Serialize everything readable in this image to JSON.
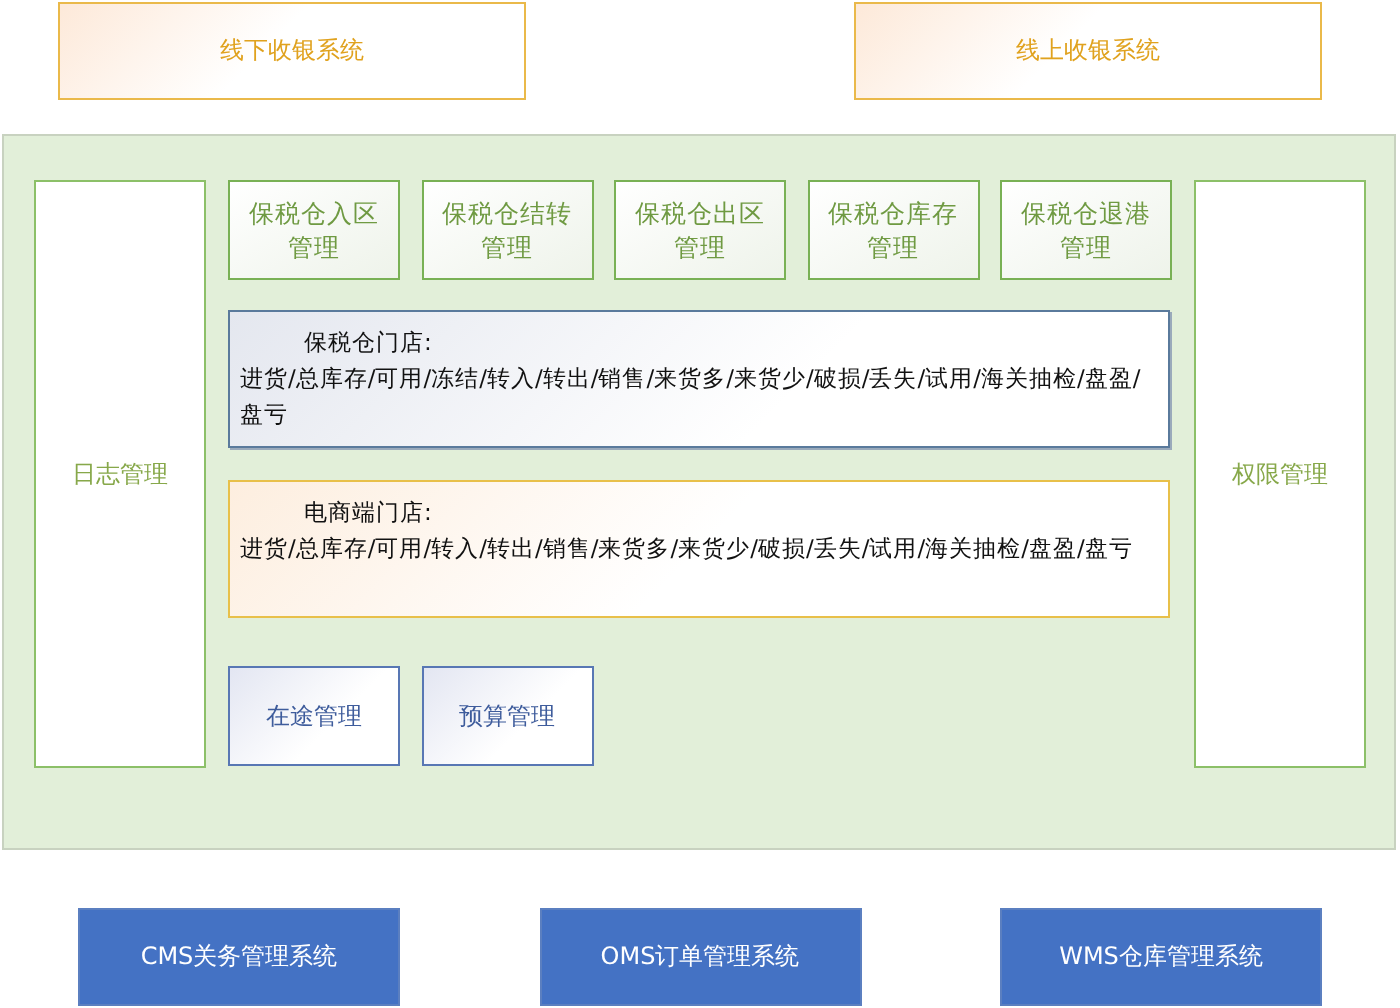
{
  "top_systems": [
    "线下收银系统",
    "线上收银系统"
  ],
  "log_panel": "日志管理",
  "modules": [
    "保税仓入区管理",
    "保税仓结转管理",
    "保税仓出区管理",
    "保税仓库存管理",
    "保税仓退港管理"
  ],
  "stores": [
    {
      "kind": "bonded",
      "title": "保税仓门店:",
      "items": "进货/总库存/可用/冻结/转入/转出/销售/来货多/来货少/破损/丢失/试用/海关抽检/盘盈/盘亏"
    },
    {
      "kind": "ecommerce",
      "title": "电商端门店:",
      "items": "进货/总库存/可用/转入/转出/销售/来货多/来货少/破损/丢失/试用/海关抽检/盘盈/盘亏"
    }
  ],
  "extra_modules": [
    "在途管理",
    "预算管理"
  ],
  "permission_panel": "权限管理",
  "bottom_systems": [
    "CMS关务管理系统",
    "OMS订单管理系统",
    "WMS仓库管理系统"
  ]
}
